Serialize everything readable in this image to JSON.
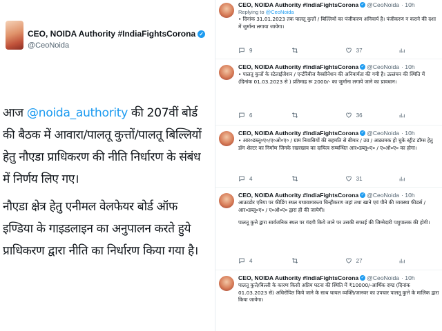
{
  "account": {
    "name": "CEO, NOIDA Authority #IndiaFightsCorona",
    "handle": "@CeoNoida",
    "time": "· 10h",
    "verified_mark": "✓"
  },
  "main_tweet": {
    "text_before_mention": "आज ",
    "mention": "@noida_authority",
    "text_after_mention": " की 207वीं बोर्ड की बैठक में आवारा/पालतू कुत्तों/पालतू बिल्लियों हेतु नौएडा प्राधिकरण की नीति निर्धारण के संबंध में निर्णय लिए गए।",
    "paragraph2": "नौएडा क्षेत्र हेतु एनीमल वेलफेयर बोर्ड ऑफ इण्डिया के गाइडलाइन का अनुपालन करते हुये प्राधिकरण द्वारा नीति का निर्धारण किया गया है।"
  },
  "thread": [
    {
      "reply_label": "Replying to",
      "reply_to": "@CeoNoida",
      "paragraphs": [
        "• दिनांक 31.01.2023 तक पालतू कुत्तों / बिल्लियों का पंजीकरण अनिवार्य है। पंजीकरण न कराने की दशा में जुर्माना लगाया जायेगा।"
      ],
      "replies": "9",
      "retweets": "",
      "likes": "37",
      "views": ""
    },
    {
      "paragraphs": [
        "• पालतू कुत्तों के स्टेलाईजेशन / एन्टीरैबीज वैक्सीनेशन की अनिवार्यता की गयी है। उल्लंघन की स्थिति में (दिनांक 01.03.2023 से ) प्रतिमाह रू 2000/- का जुर्माना लगाये जाने का प्रावधान।"
      ],
      "replies": "6",
      "retweets": "",
      "likes": "36",
      "views": ""
    },
    {
      "paragraphs": [
        "• आर०डब्लू०ए०/ए०ओ०ए० / ग्राम निवासियों की सहमति से बीमार / उग्र / आक्रामक हो चुके स्ट्रीट डॉग्स हेतु डॉग शेल्टर का निर्माण जिनके रखरखाव का दायित्व सम्बन्धित आर०डब्लू०ए० / ए०ओ०ए० का होगा।"
      ],
      "replies": "4",
      "retweets": "",
      "likes": "31",
      "views": ""
    },
    {
      "paragraphs": [
        "आउटडोर एरिया पर फीडिंग स्थल यथावश्यकता चिन्हीकरण जहां तथा खाने एवं पीने की व्यवस्था फीडर्स / आर०डब्लू०ए० / ए०ओ०ए० द्वारा ही की जायेगी।",
        "पालतू कुत्ते द्वारा सार्वजनिक स्थल पर गंदगी किये जाने पर उसकी सफाई की जिम्मेदारी पशुपालक की होगी।"
      ],
      "replies": "4",
      "retweets": "",
      "likes": "27",
      "views": ""
    },
    {
      "paragraphs": [
        "पालतू कुत्ते/बिल्ली के कारण किसी अप्रिय घटना की स्थिति में ₹10000/-आर्थिक दण्ड (दिनांक 01.03.2023 से) अधिरोपित किये जाने के साथ घायल व्यक्ति/जानवर का उपचार पालतू कुत्ते के मालिक द्वारा किया जायेगा।"
      ],
      "replies": "",
      "retweets": "",
      "likes": "",
      "views": ""
    }
  ],
  "colors": {
    "link": "#1d9bf0",
    "text": "#0f1419",
    "secondary": "#536471",
    "border": "#eff3f4"
  },
  "icons": [
    "reply-icon",
    "retweet-icon",
    "like-icon",
    "views-icon",
    "verified-badge-icon"
  ]
}
